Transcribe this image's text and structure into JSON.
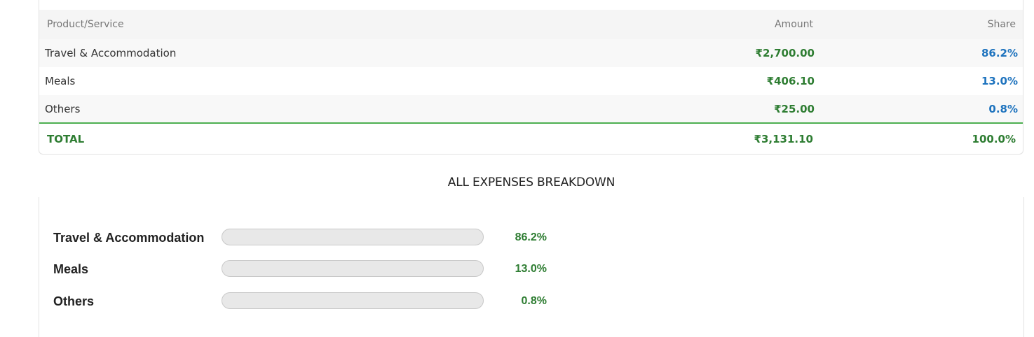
{
  "table": {
    "headers": {
      "name": "Product/Service",
      "amount": "Amount",
      "share": "Share"
    },
    "rows": [
      {
        "name": "Travel & Accommodation",
        "amount": "₹2,700.00",
        "share": "86.2%"
      },
      {
        "name": "Meals",
        "amount": "₹406.10",
        "share": "13.0%"
      },
      {
        "name": "Others",
        "amount": "₹25.00",
        "share": "0.8%"
      }
    ],
    "total": {
      "label": "TOTAL",
      "amount": "₹3,131.10",
      "share": "100.0%"
    }
  },
  "breakdown": {
    "title": "ALL EXPENSES BREAKDOWN",
    "items": [
      {
        "label": "Travel & Accommodation",
        "percent": "86.2%"
      },
      {
        "label": "Meals",
        "percent": "13.0%"
      },
      {
        "label": "Others",
        "percent": "0.8%"
      }
    ]
  },
  "colors": {
    "amount": "#2e7d32",
    "share": "#1e73be",
    "total": "#2e7d32",
    "total_rule": "#4caf50",
    "bar_track": "#e8e8e8"
  }
}
